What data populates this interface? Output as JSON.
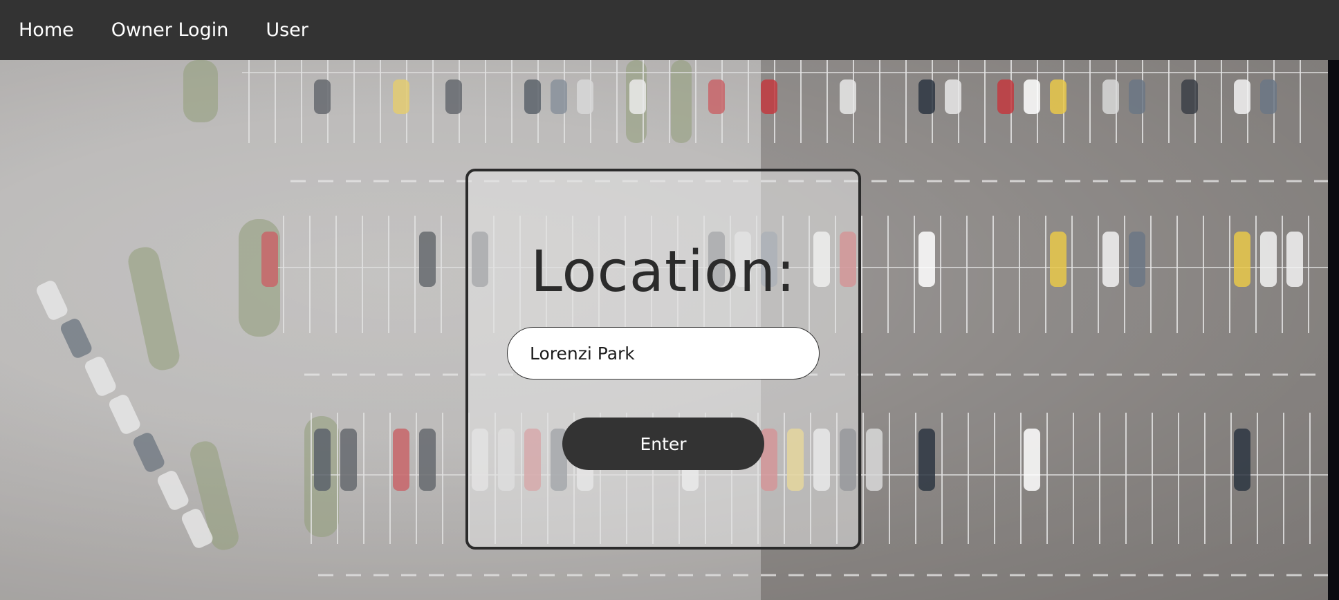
{
  "nav": {
    "items": [
      {
        "label": "Home"
      },
      {
        "label": "Owner Login"
      },
      {
        "label": "User"
      }
    ]
  },
  "form": {
    "title": "Location:",
    "location_value": "Lorenzi Park",
    "submit_label": "Enter"
  },
  "colors": {
    "navbar": "#333333",
    "button": "#333333",
    "card_border": "#2b2b2b"
  }
}
